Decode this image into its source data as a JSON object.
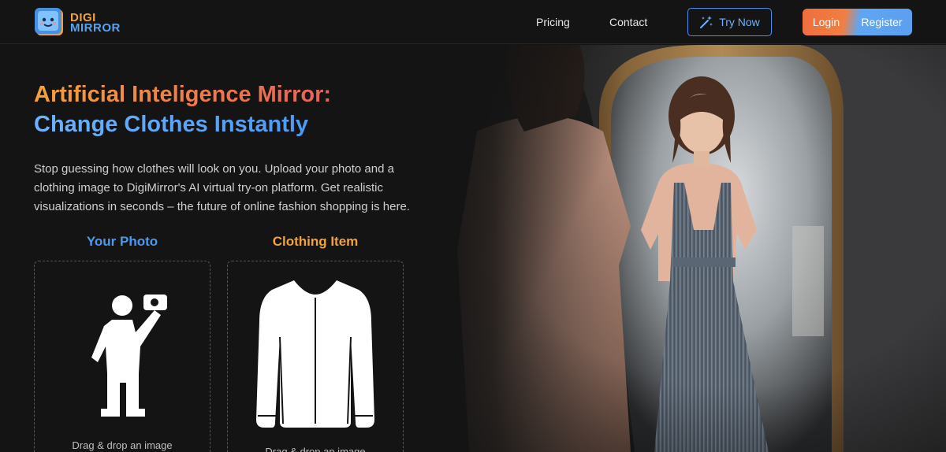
{
  "brand": {
    "line1": "DIGI",
    "line2": "MIRROR"
  },
  "nav": {
    "pricing": "Pricing",
    "contact": "Contact"
  },
  "actions": {
    "try_now": "Try Now",
    "login": "Login",
    "register": "Register"
  },
  "hero": {
    "headline_line1": "Artificial Inteligence Mirror:",
    "headline_line2": "Change Clothes Instantly",
    "description": "Stop guessing how clothes will look on you. Upload your photo and a clothing image to DigiMirror's AI virtual try-on platform. Get realistic visualizations in seconds – the future of online fashion shopping is here."
  },
  "upload": {
    "photo_label": "Your Photo",
    "clothing_label": "Clothing Item",
    "photo_hint": "Drag & drop an image",
    "clothing_hint": "Drag & drop an image"
  },
  "colors": {
    "accent_orange": "#f4a23a",
    "accent_blue": "#4b9af0",
    "background": "#141414"
  },
  "icons": [
    "try-now-wand-icon",
    "selfie-person-icon",
    "shirt-icon",
    "logo-mirror-icon"
  ]
}
